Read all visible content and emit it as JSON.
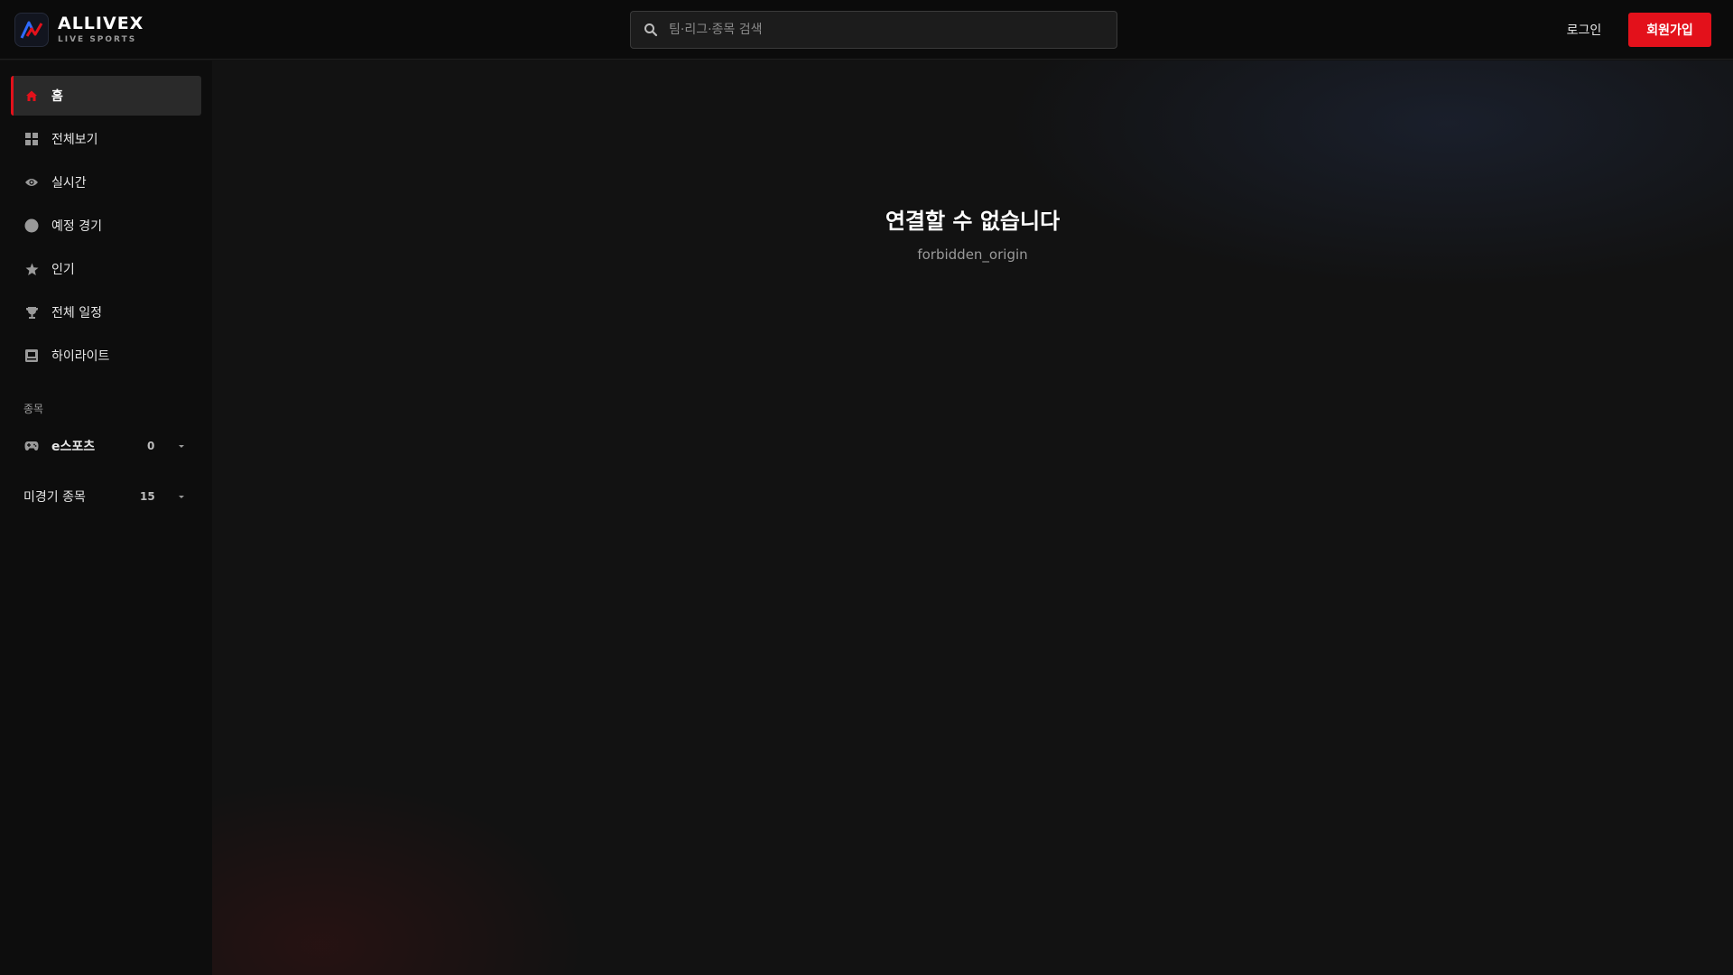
{
  "brand": {
    "name": "ALLIVEX",
    "tagline": "LIVE SPORTS"
  },
  "search": {
    "placeholder": "팀·리그·종목 검색",
    "value": ""
  },
  "header": {
    "login_label": "로그인",
    "signup_label": "회원가입"
  },
  "colors": {
    "accent": "#e3111b",
    "background": "#121212",
    "sidebar": "#0d0d0d"
  },
  "sidebar": {
    "items": [
      {
        "label": "홈",
        "icon": "home-icon",
        "active": true
      },
      {
        "label": "전체보기",
        "icon": "grid-icon",
        "active": false
      },
      {
        "label": "실시간",
        "icon": "eye-icon",
        "active": false
      },
      {
        "label": "예정 경기",
        "icon": "circle-icon",
        "active": false
      },
      {
        "label": "인기",
        "icon": "star-icon",
        "active": false
      },
      {
        "label": "전체 일정",
        "icon": "trophy-icon",
        "active": false
      },
      {
        "label": "하이라이트",
        "icon": "film-icon",
        "active": false
      }
    ],
    "section_title": "종목",
    "categories": [
      {
        "label": "e스포츠",
        "count": "0",
        "icon": "gamepad-icon"
      },
      {
        "label": "미경기 종목",
        "count": "15"
      }
    ]
  },
  "main": {
    "error_title": "연결할 수 없습니다",
    "error_detail": "forbidden_origin"
  }
}
